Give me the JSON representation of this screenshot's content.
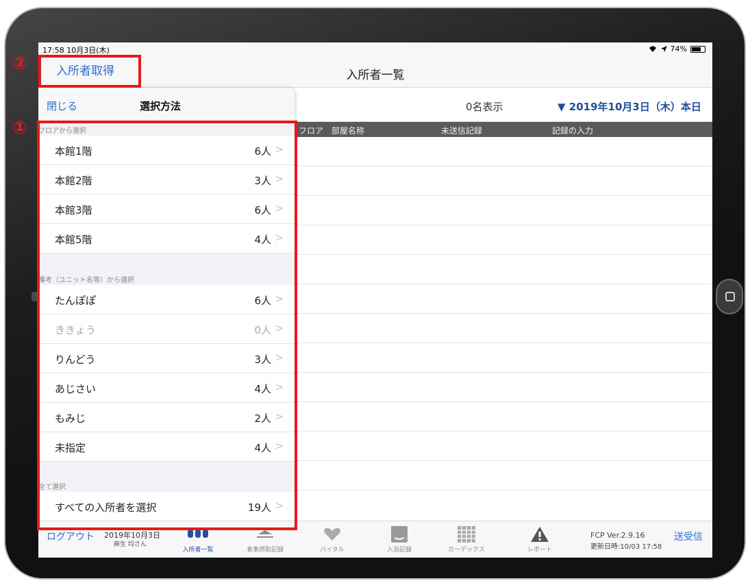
{
  "status": {
    "time": "17:58  10月3日(木)",
    "battery": "74%"
  },
  "nav": {
    "title": "入所者一覧",
    "left_button": "入所者取得"
  },
  "content": {
    "count_label": "0名表示",
    "date_label": "▼ 2019年10月3日（木）本日",
    "columns": [
      "フロア",
      "部屋名称",
      "未送信記録",
      "記録の入力"
    ]
  },
  "popover": {
    "close_label": "閉じる",
    "title": "選択方法",
    "sections": [
      {
        "label": "フロアから選択",
        "items": [
          {
            "label": "本館1階",
            "count": "6人"
          },
          {
            "label": "本館2階",
            "count": "3人"
          },
          {
            "label": "本館3階",
            "count": "6人"
          },
          {
            "label": "本館5階",
            "count": "4人"
          }
        ]
      },
      {
        "label": "備考（ユニット名等）から選択",
        "items": [
          {
            "label": "たんぽぽ",
            "count": "6人"
          },
          {
            "label": "ききょう",
            "count": "0人"
          },
          {
            "label": "りんどう",
            "count": "3人"
          },
          {
            "label": "あじさい",
            "count": "4人"
          },
          {
            "label": "もみじ",
            "count": "2人"
          },
          {
            "label": "未指定",
            "count": "4人"
          }
        ]
      },
      {
        "label": "全て選択",
        "items": [
          {
            "label": "すべての入所者を選択",
            "count": "19人"
          }
        ]
      }
    ]
  },
  "tabbar": {
    "logout": "ログアウト",
    "date": "2019年10月3日",
    "user": "麻生 均さん",
    "tabs": [
      {
        "label": "入所者一覧",
        "icon": "residents-icon"
      },
      {
        "label": "食事摂取記録",
        "icon": "meal-icon"
      },
      {
        "label": "バイタル",
        "icon": "heart-icon"
      },
      {
        "label": "入浴記録",
        "icon": "bath-icon"
      },
      {
        "label": "カーデックス",
        "icon": "grid-icon"
      },
      {
        "label": "レポート",
        "icon": "warning-icon"
      }
    ],
    "version": "FCP Ver.2.9.16",
    "updated": "更新日時:10/03 17:58",
    "sync": "送受信"
  },
  "annotations": {
    "one": "①",
    "two": "②"
  },
  "colors": {
    "accent": "#2f6fcb",
    "annotation": "#e51a1a",
    "header": "#5a5a5a"
  }
}
